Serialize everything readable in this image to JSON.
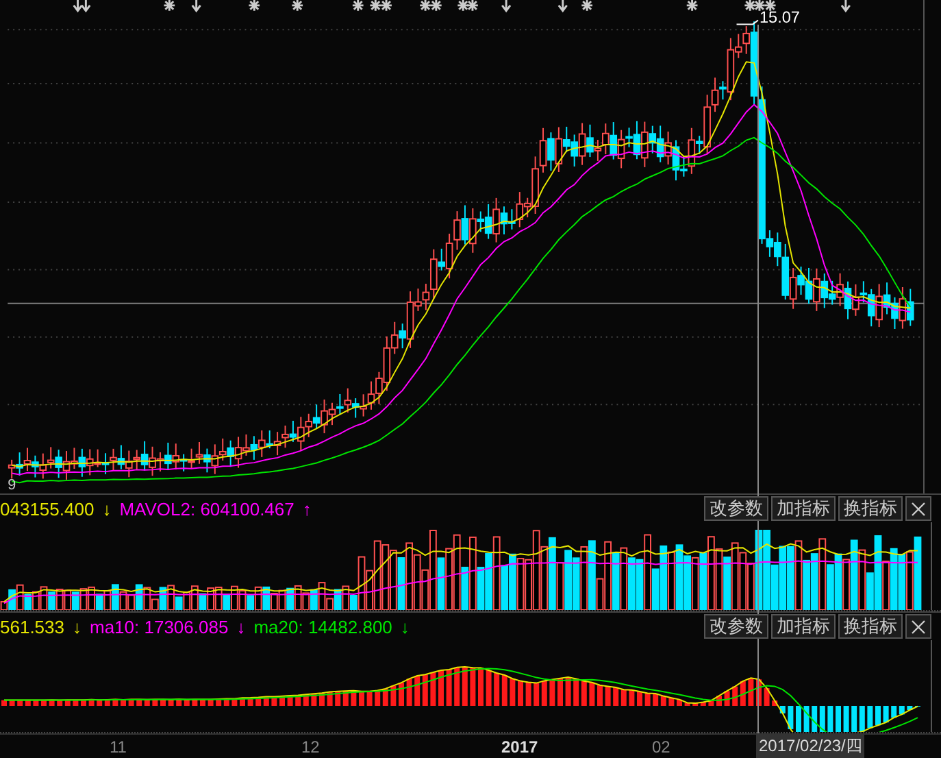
{
  "main_chart": {
    "high_label": "15.07",
    "left_edge_label": "9"
  },
  "volume_panel": {
    "indicators": [
      {
        "text": "043155.400",
        "trend": "↓",
        "color": "#e6e600"
      },
      {
        "text": "MAVOL2: 604100.467",
        "trend": "↑",
        "color": "#ff00ff"
      }
    ],
    "buttons": [
      "改参数",
      "加指标",
      "换指标"
    ]
  },
  "macd_panel": {
    "indicators": [
      {
        "text": "561.533",
        "trend": "↓",
        "color": "#e6e600"
      },
      {
        "text": "ma10: 17306.085",
        "trend": "↓",
        "color": "#ff00ff"
      },
      {
        "text": "ma20: 14482.800",
        "trend": "↓",
        "color": "#00e600"
      }
    ],
    "buttons": [
      "改参数",
      "加指标",
      "换指标"
    ]
  },
  "time_axis": {
    "labels": [
      "11",
      "12",
      "2017",
      "02"
    ],
    "cursor_date": "2017/02/23/四"
  }
}
